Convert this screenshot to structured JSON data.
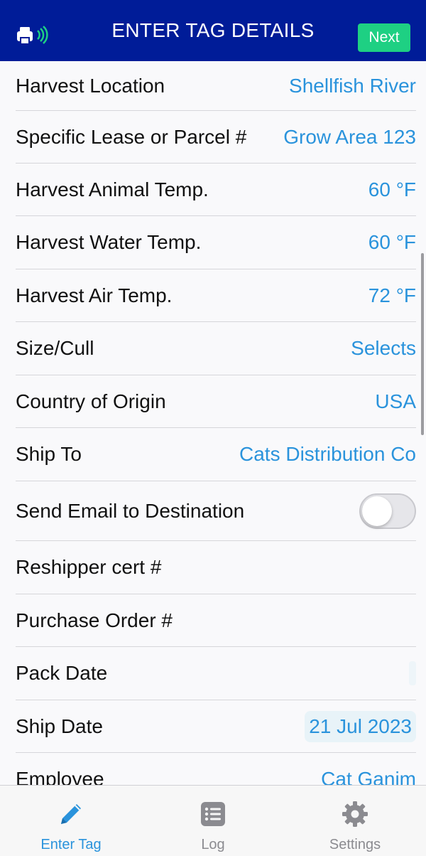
{
  "header": {
    "title": "ENTER TAG DETAILS",
    "next_label": "Next",
    "printer_icon": "printer-icon",
    "printer_status_color": "#1ed083"
  },
  "colors": {
    "header_bg": "#001c98",
    "accent": "#2a93dc",
    "next_bg": "#1ed083"
  },
  "fields": [
    {
      "label": "Harvest Location",
      "value": "Shellfish River"
    },
    {
      "label": "Specific Lease or Parcel #",
      "value": "Grow Area 123"
    },
    {
      "label": "Harvest Animal Temp.",
      "value": "60 °F"
    },
    {
      "label": "Harvest Water Temp.",
      "value": "60 °F"
    },
    {
      "label": "Harvest Air Temp.",
      "value": "72 °F"
    },
    {
      "label": "Size/Cull",
      "value": "Selects"
    },
    {
      "label": "Country of Origin",
      "value": "USA"
    },
    {
      "label": "Ship To",
      "value": "Cats Distribution Co"
    },
    {
      "label": "Send Email to Destination",
      "toggle_on": false
    },
    {
      "label": "Reshipper cert #",
      "value": ""
    },
    {
      "label": "Purchase Order #",
      "value": ""
    },
    {
      "label": "Pack Date",
      "value": ""
    },
    {
      "label": "Ship Date",
      "value": "21 Jul 2023"
    },
    {
      "label": "Employee",
      "value": "Cat Ganim"
    }
  ],
  "tabs": [
    {
      "label": "Enter Tag",
      "icon": "pencil-icon",
      "active": true
    },
    {
      "label": "Log",
      "icon": "list-icon",
      "active": false
    },
    {
      "label": "Settings",
      "icon": "gear-icon",
      "active": false
    }
  ]
}
